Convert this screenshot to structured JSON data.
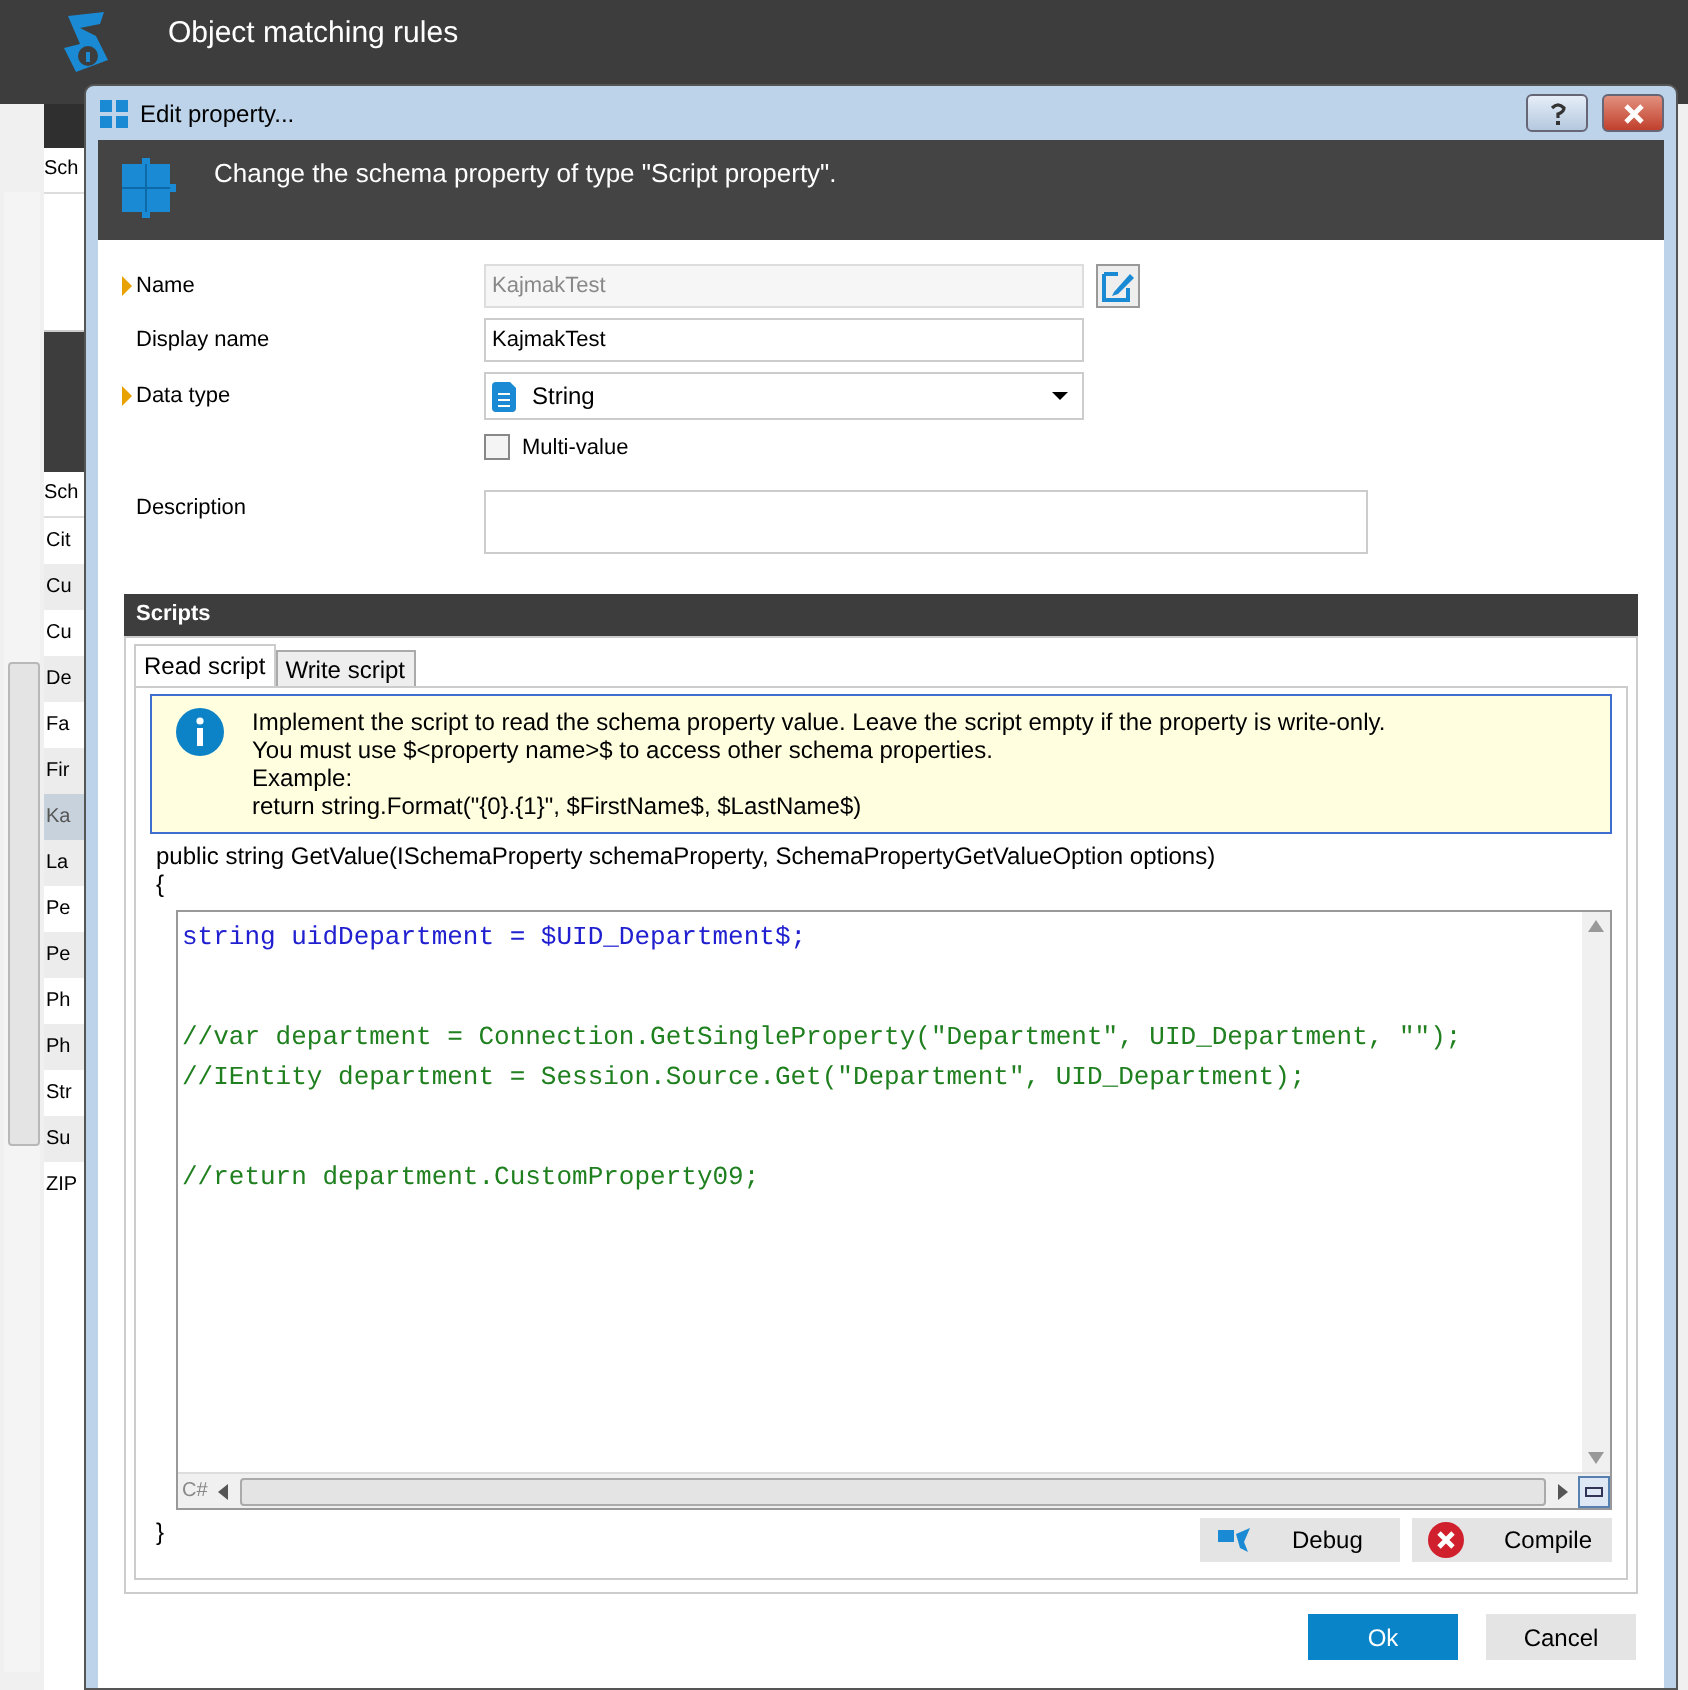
{
  "app": {
    "title": "Object matching rules",
    "panel_header": "Sch",
    "list_header": "Sch",
    "items": [
      {
        "label": "Cit",
        "selected": false
      },
      {
        "label": "Cu",
        "selected": false
      },
      {
        "label": "Cu",
        "selected": false
      },
      {
        "label": "De",
        "selected": false
      },
      {
        "label": "Fa",
        "selected": false
      },
      {
        "label": "Fir",
        "selected": false
      },
      {
        "label": "Ka",
        "selected": true
      },
      {
        "label": "La",
        "selected": false
      },
      {
        "label": "Pe",
        "selected": false
      },
      {
        "label": "Pe",
        "selected": false
      },
      {
        "label": "Ph",
        "selected": false
      },
      {
        "label": "Ph",
        "selected": false
      },
      {
        "label": "Str",
        "selected": false
      },
      {
        "label": "Su",
        "selected": false
      },
      {
        "label": "ZIP",
        "selected": false
      }
    ]
  },
  "dialog": {
    "title": "Edit property...",
    "header": "Change the schema property of type \"Script property\".",
    "fields": [
      {
        "kind": "text",
        "label": "Name",
        "required": true,
        "value": "KajmakTest",
        "disabled": true
      },
      {
        "kind": "text",
        "label": "Display name",
        "required": false,
        "value": "KajmakTest",
        "disabled": false
      },
      {
        "kind": "select",
        "label": "Data type",
        "required": true,
        "value": "String"
      },
      {
        "kind": "checkbox",
        "label": "Multi-value",
        "checked": false
      },
      {
        "kind": "area",
        "label": "Description",
        "required": false
      }
    ],
    "scripts": {
      "title": "Scripts",
      "tabs": [
        {
          "label": "Read script",
          "selected": true
        },
        {
          "label": "Write script",
          "selected": false
        }
      ],
      "info": [
        "Implement the script to read the schema property value. Leave the script empty if the property is write-only.",
        "You must use $<property name>$ to access other schema properties.",
        "Example:",
        "return string.Format(\"{0}.{1}\", $FirstName$, $LastName$)"
      ],
      "signature": "public string GetValue(ISchemaProperty schemaProperty, SchemaPropertyGetValueOption options)",
      "open_brace": "{",
      "close_brace": "}",
      "code_blocks": [
        [
          {
            "kind": "code",
            "text": "string uidDepartment = $UID_Department$;"
          }
        ],
        [
          {
            "kind": "comment",
            "text": "//var department = Connection.GetSingleProperty(\"Department\", UID_Department, \"\");"
          },
          {
            "kind": "comment",
            "text": "//IEntity department = Session.Source.Get(\"Department\", UID_Department);"
          }
        ],
        [
          {
            "kind": "comment",
            "text": "//return department.CustomProperty09;"
          }
        ]
      ],
      "language": "C#",
      "buttons": [
        "Debug",
        "Compile"
      ]
    },
    "buttons": [
      {
        "label": "Ok",
        "primary": true
      },
      {
        "label": "Cancel",
        "primary": false
      }
    ]
  }
}
